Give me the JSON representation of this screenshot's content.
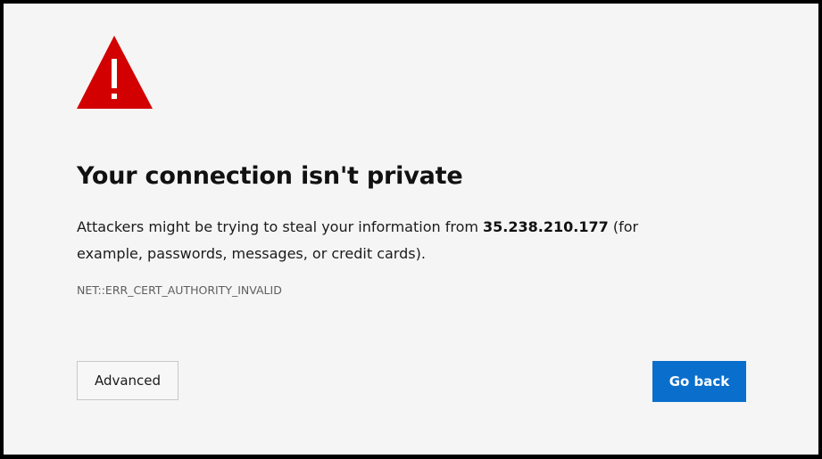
{
  "icon": {
    "name": "warning-triangle-icon",
    "color": "#d20000"
  },
  "page": {
    "title": "Your connection isn't private",
    "message_before": "Attackers might be trying to steal your information from ",
    "host": "35.238.210.177",
    "message_after": " (for example, passwords, messages, or credit cards).",
    "error_code": "NET::ERR_CERT_AUTHORITY_INVALID"
  },
  "buttons": {
    "advanced_label": "Advanced",
    "go_back_label": "Go back"
  },
  "colors": {
    "background": "#f5f5f5",
    "primary_button": "#0a6fcc",
    "warning": "#d20000"
  }
}
